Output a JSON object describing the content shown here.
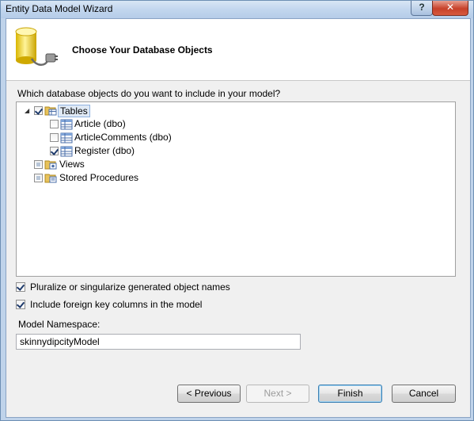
{
  "window": {
    "title": "Entity Data Model Wizard",
    "help_label": "?",
    "close_label": "✕"
  },
  "header": {
    "title": "Choose Your Database Objects"
  },
  "question": "Which database objects do you want to include in your model?",
  "tree": {
    "tables": {
      "label": "Tables",
      "state": "checked",
      "expanded": true,
      "children": [
        {
          "label": "Article (dbo)",
          "checked": false
        },
        {
          "label": "ArticleComments (dbo)",
          "checked": false
        },
        {
          "label": "Register (dbo)",
          "checked": true
        }
      ]
    },
    "views": {
      "label": "Views",
      "state": "unchecked"
    },
    "stored_procedures": {
      "label": "Stored Procedures",
      "state": "unchecked"
    }
  },
  "options": {
    "pluralize": {
      "label": "Pluralize or singularize generated object names",
      "checked": true
    },
    "foreign_keys": {
      "label": "Include foreign key columns in the model",
      "checked": true
    }
  },
  "namespace": {
    "label": "Model Namespace:",
    "value": "skinnydipcityModel"
  },
  "buttons": {
    "previous": "< Previous",
    "next": "Next >",
    "finish": "Finish",
    "cancel": "Cancel"
  },
  "colors": {
    "title_bar": "#c2d6ee",
    "close_button": "#c7412a",
    "dialog_background": "#f0f0f0"
  }
}
